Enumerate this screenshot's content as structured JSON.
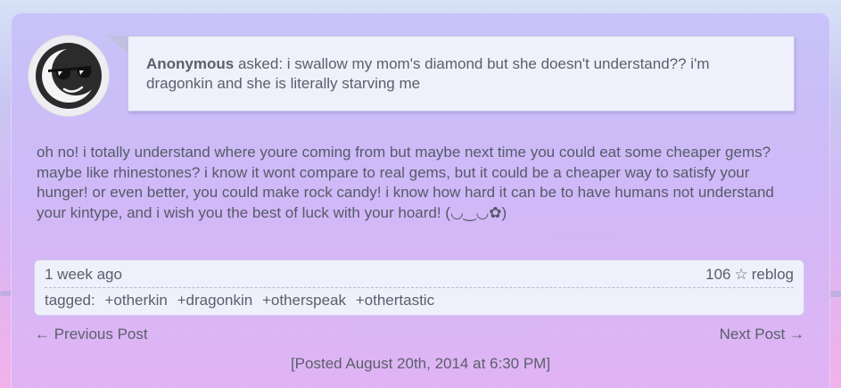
{
  "ask": {
    "asker": "Anonymous",
    "verb": "asked:",
    "question": "i swallow my mom's diamond but she doesn't understand?? i'm dragonkin and she is literally starving me"
  },
  "avatar": {
    "icon": "sunglasses-moon-face-icon"
  },
  "answer": {
    "text": "oh no! i totally understand where youre coming from but maybe next time you could eat some cheaper gems? maybe like rhinestones? i know it wont compare to real gems, but it could be a cheaper way to satisfy your hunger! or even better, you could make rock candy! i know how hard it can be to have humans not understand your kintype, and i wish you the best of luck with your hoard! (◡‿◡✿)"
  },
  "meta": {
    "time": "1 week ago",
    "notes_count": "106",
    "star_glyph": "☆",
    "reblog_label": "reblog",
    "tags_label": "tagged:",
    "tags": [
      "+otherkin",
      "+dragonkin",
      "+otherspeak",
      "+othertastic"
    ]
  },
  "nav": {
    "prev": "← Previous Post",
    "next": "Next Post →"
  },
  "posted": "[Posted August 20th, 2014 at 6:30 PM]",
  "colors": {
    "card": "#cdbaf7",
    "box": "#eff0fb",
    "text": "#555a68"
  }
}
